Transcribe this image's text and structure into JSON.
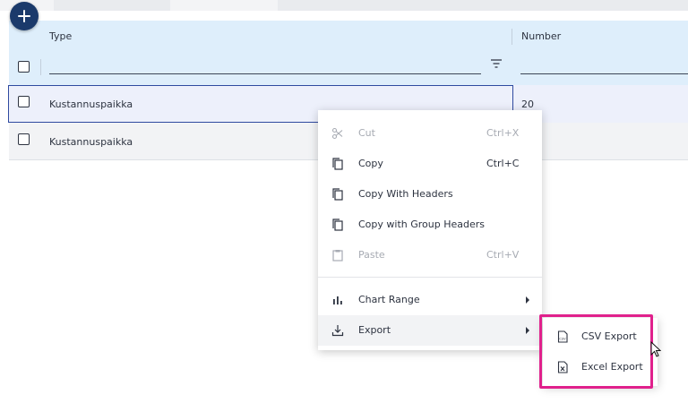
{
  "add_button": {
    "icon": "plus-icon"
  },
  "grid": {
    "columns": [
      "Type",
      "Number"
    ],
    "filter": {
      "value": "",
      "icon": "filter-icon"
    },
    "rows": [
      {
        "type": "Kustannuspaikka",
        "number": "20"
      },
      {
        "type": "Kustannuspaikka",
        "number": ""
      }
    ]
  },
  "context_menu": {
    "items": [
      {
        "label": "Cut",
        "shortcut": "Ctrl+X",
        "icon": "scissors-icon",
        "disabled": true
      },
      {
        "label": "Copy",
        "shortcut": "Ctrl+C",
        "icon": "copy-icon",
        "disabled": false
      },
      {
        "label": "Copy With Headers",
        "shortcut": "",
        "icon": "copy-icon",
        "disabled": false
      },
      {
        "label": "Copy with Group Headers",
        "shortcut": "",
        "icon": "copy-icon",
        "disabled": false
      },
      {
        "label": "Paste",
        "shortcut": "Ctrl+V",
        "icon": "clipboard-icon",
        "disabled": true
      },
      {
        "label": "Chart Range",
        "shortcut": "",
        "icon": "bar-chart-icon",
        "has_submenu": true
      },
      {
        "label": "Export",
        "shortcut": "",
        "icon": "download-icon",
        "has_submenu": true,
        "active": true
      }
    ]
  },
  "export_submenu": {
    "items": [
      {
        "label": "CSV Export",
        "icon": "csv-file-icon"
      },
      {
        "label": "Excel Export",
        "icon": "excel-file-icon"
      }
    ]
  },
  "colors": {
    "accent": "#1b3a6b",
    "header_bg": "#deeefb",
    "highlight": "#e0208c"
  }
}
